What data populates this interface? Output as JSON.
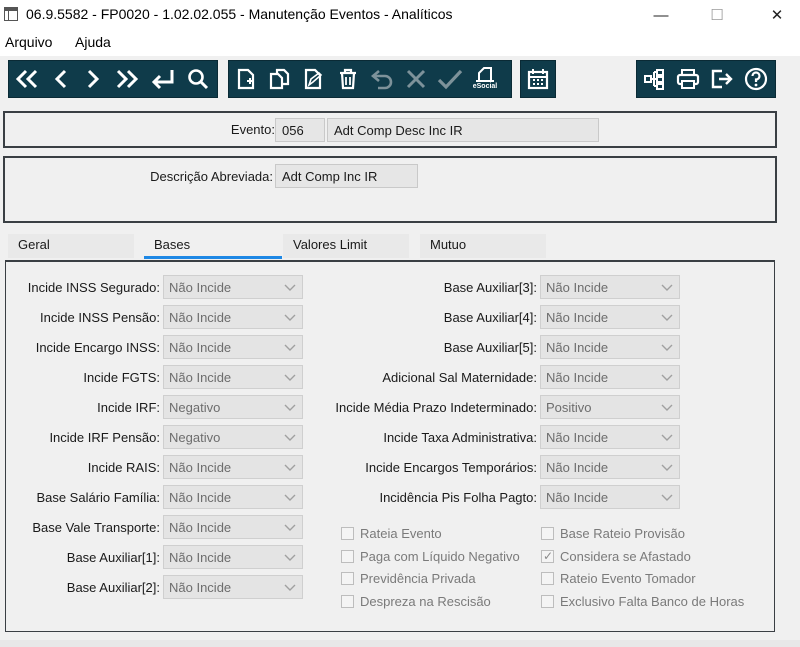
{
  "window": {
    "title": "06.9.5582 - FP0020 - 1.02.02.055 - Manutenção Eventos - Analíticos",
    "minimize": "—",
    "maximize": "☐",
    "close": "✕"
  },
  "menu": {
    "items": [
      "Arquivo",
      "Ajuda"
    ]
  },
  "toolbar": {
    "nav": [
      "first-icon",
      "prev-icon",
      "next-icon",
      "last-icon",
      "enter-icon",
      "search-icon"
    ],
    "edit": [
      "new-icon",
      "copy-icon",
      "edit-icon",
      "delete-icon",
      "undo-icon",
      "cancel-icon",
      "confirm-icon",
      "esocial-icon"
    ],
    "esocial_label": "eSocial",
    "right": [
      "tree-icon",
      "print-icon",
      "exit-icon",
      "help-icon"
    ]
  },
  "evento": {
    "label": "Evento:",
    "code": "056",
    "name": "Adt Comp Desc Inc IR"
  },
  "descricao": {
    "label": "Descrição Abreviada:",
    "value": "Adt Comp Inc IR"
  },
  "tabs": [
    {
      "label": "Geral",
      "active": false
    },
    {
      "label": "Bases",
      "active": true
    },
    {
      "label": "Valores Limit",
      "active": false
    },
    {
      "label": "Mutuo",
      "active": false
    }
  ],
  "left_fields": [
    {
      "label": "Incide INSS Segurado:",
      "value": "Não Incide"
    },
    {
      "label": "Incide INSS Pensão:",
      "value": "Não Incide"
    },
    {
      "label": "Incide Encargo INSS:",
      "value": "Não Incide"
    },
    {
      "label": "Incide FGTS:",
      "value": "Não Incide"
    },
    {
      "label": "Incide IRF:",
      "value": "Negativo"
    },
    {
      "label": "Incide IRF Pensão:",
      "value": "Negativo"
    },
    {
      "label": "Incide RAIS:",
      "value": "Não Incide"
    },
    {
      "label": "Base Salário Família:",
      "value": "Não Incide"
    },
    {
      "label": "Base Vale Transporte:",
      "value": "Não Incide"
    },
    {
      "label": "Base Auxiliar[1]:",
      "value": "Não Incide"
    },
    {
      "label": "Base Auxiliar[2]:",
      "value": "Não Incide"
    }
  ],
  "right_fields": [
    {
      "label": "Base Auxiliar[3]:",
      "value": "Não Incide"
    },
    {
      "label": "Base Auxiliar[4]:",
      "value": "Não Incide"
    },
    {
      "label": "Base Auxiliar[5]:",
      "value": "Não Incide"
    },
    {
      "label": "Adicional Sal Maternidade:",
      "value": "Não Incide"
    },
    {
      "label": "Incide Média Prazo Indeterminado:",
      "value": "Positivo"
    },
    {
      "label": "Incide Taxa Administrativa:",
      "value": "Não Incide"
    },
    {
      "label": "Incide Encargos Temporários:",
      "value": "Não Incide"
    },
    {
      "label": "Incidência Pis Folha Pagto:",
      "value": "Não Incide"
    }
  ],
  "checkboxes_left": [
    {
      "label": "Rateia Evento",
      "checked": false
    },
    {
      "label": "Paga com Líquido Negativo",
      "checked": false
    },
    {
      "label": "Previdência Privada",
      "checked": false
    },
    {
      "label": "Despreza na Rescisão",
      "checked": false
    }
  ],
  "checkboxes_right": [
    {
      "label": "Base Rateio Provisão",
      "checked": false
    },
    {
      "label": "Considera se Afastado",
      "checked": true
    },
    {
      "label": "Rateio Evento Tomador",
      "checked": false
    },
    {
      "label": "Exclusivo Falta Banco de Horas",
      "checked": false
    }
  ]
}
